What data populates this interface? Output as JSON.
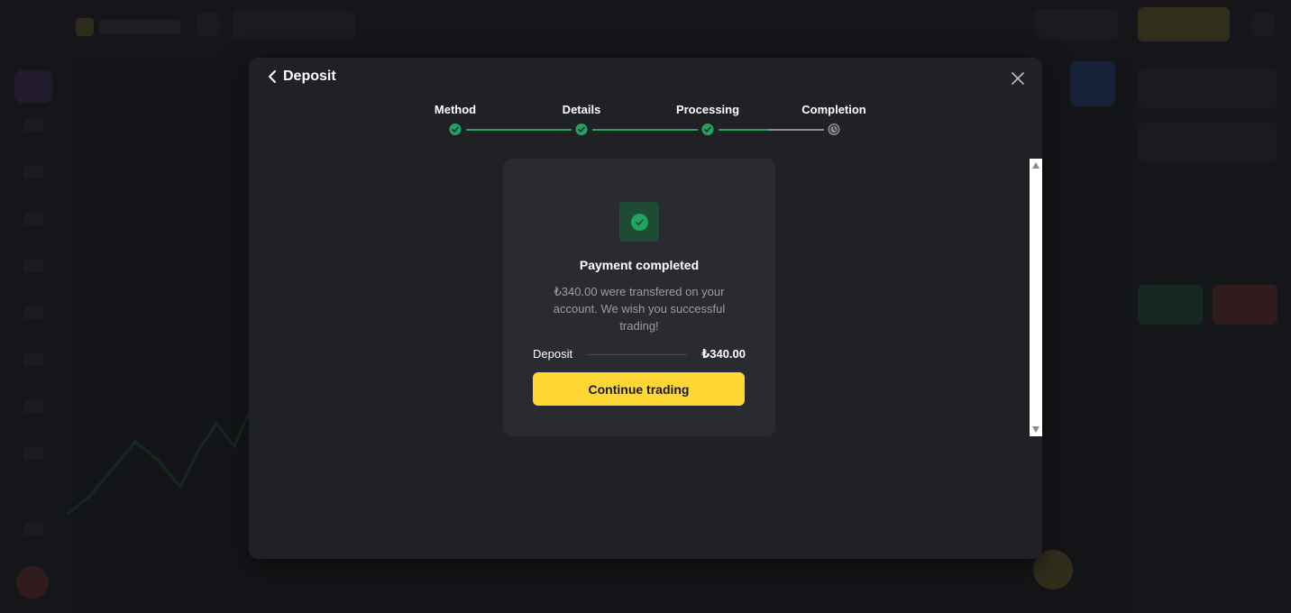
{
  "modal": {
    "title": "Deposit",
    "back_icon": "chevron-left-icon",
    "close_icon": "close-icon"
  },
  "stepper": {
    "steps": [
      {
        "label": "Method",
        "status": "done"
      },
      {
        "label": "Details",
        "status": "done"
      },
      {
        "label": "Processing",
        "status": "done"
      },
      {
        "label": "Completion",
        "status": "pending"
      }
    ]
  },
  "card": {
    "icon": "check-circle-icon",
    "title": "Payment completed",
    "message": "₺340.00 were transfered on your account. We wish you successful trading!",
    "deposit_label": "Deposit",
    "deposit_amount": "₺340.00",
    "continue_label": "Continue trading"
  },
  "colors": {
    "accent_yellow": "#ffd735",
    "success_green": "#21a361",
    "modal_bg": "#202125",
    "card_bg": "#2a2b30"
  }
}
